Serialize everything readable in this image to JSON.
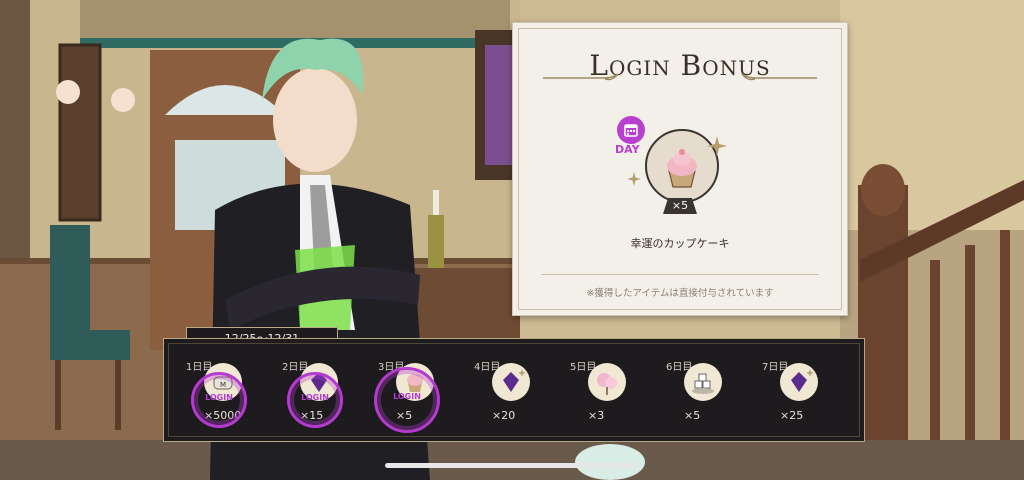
{
  "login_bonus": {
    "title": "Login Bonus",
    "day_badge": "DAY",
    "reward": {
      "icon": "cupcake-icon",
      "count": "×5",
      "name": "幸運のカップケーキ"
    },
    "note": "※獲得したアイテムは直接付与されています"
  },
  "calendar": {
    "date_range": "12/25〜12/31",
    "stamp_text": "LOGIN",
    "days": [
      {
        "label": "1日目",
        "icon": "coin-bag-icon",
        "qty": "×5000",
        "claimed": true
      },
      {
        "label": "2日目",
        "icon": "gem-icon",
        "qty": "×15",
        "claimed": true
      },
      {
        "label": "3日目",
        "icon": "cupcake-icon",
        "qty": "×5",
        "claimed": true
      },
      {
        "label": "4日目",
        "icon": "gem-icon",
        "qty": "×20",
        "claimed": false
      },
      {
        "label": "5日目",
        "icon": "cotton-candy-icon",
        "qty": "×3",
        "claimed": false
      },
      {
        "label": "6日目",
        "icon": "sugar-cubes-icon",
        "qty": "×5",
        "claimed": false
      },
      {
        "label": "7日目",
        "icon": "gem-icon",
        "qty": "×25",
        "claimed": false
      }
    ]
  },
  "colors": {
    "accent": "#b93fd0",
    "bar": "#1d1b1e",
    "card": "#f3f0ea"
  }
}
